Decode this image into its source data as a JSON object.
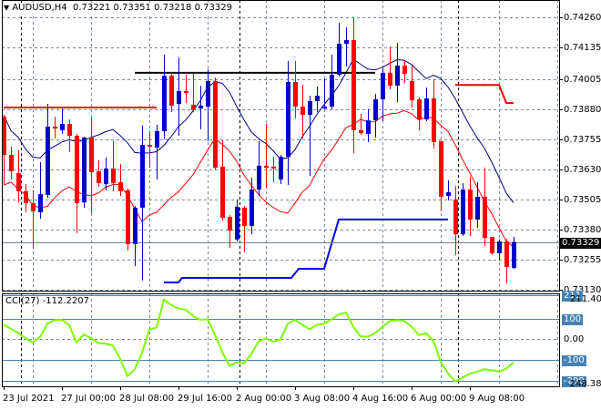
{
  "header": {
    "menu_icon": "triangle-down-icon",
    "symbol": "AUDUSD,H4",
    "ohlc": "0.73221 0.73351 0.73218 0.73329"
  },
  "indicator": {
    "label": "CCI(27) -112.2207"
  },
  "colors": {
    "bull": "#0000c8",
    "bear": "#ff0000",
    "ma_upper": "#000080",
    "ma_lower": "#ff0000",
    "cci": "#7cfc00",
    "level": "#4682b4",
    "grid": "#778899"
  },
  "chart_data": [
    {
      "type": "candlestick",
      "title": "AUDUSD,H4",
      "ylabel": "",
      "ylim": [
        0.7313,
        0.7426
      ],
      "y_ticks": [
        "0.74260",
        "0.74135",
        "0.74005",
        "0.73880",
        "0.73755",
        "0.73630",
        "0.73505",
        "0.73380",
        "0.73255",
        "0.73130"
      ],
      "current_price": "0.73329",
      "x_tick_labels": [
        {
          "bar": 0,
          "label": "23 Jul 2021"
        },
        {
          "bar": 8,
          "label": "27 Jul 00:00"
        },
        {
          "bar": 16,
          "label": "28 Jul 08:00"
        },
        {
          "bar": 24,
          "label": "29 Jul 16:00"
        },
        {
          "bar": 32,
          "label": "2 Aug 00:00"
        },
        {
          "bar": 40,
          "label": "3 Aug 08:00"
        },
        {
          "bar": 48,
          "label": "4 Aug 16:00"
        },
        {
          "bar": 56,
          "label": "6 Aug 00:00"
        },
        {
          "bar": 64,
          "label": "9 Aug 08:00"
        }
      ],
      "period_separators": [
        2,
        32,
        62
      ],
      "ohlc": [
        [
          0.73848,
          0.73856,
          0.73565,
          0.7369
        ],
        [
          0.7369,
          0.73724,
          0.73588,
          0.73622
        ],
        [
          0.73614,
          0.73709,
          0.73493,
          0.73539
        ],
        [
          0.73539,
          0.73569,
          0.73452,
          0.7349
        ],
        [
          0.7349,
          0.73543,
          0.73301,
          0.73456
        ],
        [
          0.73452,
          0.7366,
          0.73425,
          0.73527
        ],
        [
          0.73524,
          0.73901,
          0.73512,
          0.73807
        ],
        [
          0.73807,
          0.73848,
          0.73758,
          0.73799
        ],
        [
          0.73792,
          0.73882,
          0.73777,
          0.73818
        ],
        [
          0.73818,
          0.73837,
          0.73701,
          0.73769
        ],
        [
          0.73769,
          0.73777,
          0.73365,
          0.7349
        ],
        [
          0.73493,
          0.73765,
          0.73471,
          0.73762
        ],
        [
          0.73762,
          0.73845,
          0.73448,
          0.73618
        ],
        [
          0.73622,
          0.73667,
          0.73558,
          0.73573
        ],
        [
          0.73569,
          0.73679,
          0.73543,
          0.73633
        ],
        [
          0.73633,
          0.73747,
          0.73539,
          0.73573
        ],
        [
          0.73577,
          0.73652,
          0.7352,
          0.73539
        ],
        [
          0.73543,
          0.7355,
          0.73293,
          0.7332
        ],
        [
          0.7332,
          0.73478,
          0.73229,
          0.73471
        ],
        [
          0.73471,
          0.73811,
          0.73169,
          0.73731
        ],
        [
          0.73731,
          0.73788,
          0.73637,
          0.73724
        ],
        [
          0.7372,
          0.73814,
          0.73588,
          0.73788
        ],
        [
          0.73788,
          0.74105,
          0.73754,
          0.74018
        ],
        [
          0.74018,
          0.7403,
          0.73867,
          0.73894
        ],
        [
          0.73901,
          0.74094,
          0.73769,
          0.73954
        ],
        [
          0.73954,
          0.74022,
          0.73905,
          0.73947
        ],
        [
          0.73898,
          0.74026,
          0.73867,
          0.73875
        ],
        [
          0.73882,
          0.73977,
          0.73796,
          0.73894
        ],
        [
          0.7389,
          0.74045,
          0.73747,
          0.73996
        ],
        [
          0.73996,
          0.74011,
          0.73629,
          0.73637
        ],
        [
          0.73641,
          0.7375,
          0.73418,
          0.73429
        ],
        [
          0.73433,
          0.73441,
          0.73305,
          0.73376
        ],
        [
          0.73339,
          0.73505,
          0.73331,
          0.73475
        ],
        [
          0.73471,
          0.73478,
          0.73286,
          0.73395
        ],
        [
          0.73395,
          0.73595,
          0.73361,
          0.73546
        ],
        [
          0.73546,
          0.73747,
          0.7352,
          0.73645
        ],
        [
          0.73645,
          0.73818,
          0.7355,
          0.73637
        ],
        [
          0.73641,
          0.73682,
          0.73577,
          0.73633
        ],
        [
          0.73588,
          0.7369,
          0.73569,
          0.73682
        ],
        [
          0.73682,
          0.74079,
          0.73565,
          0.73992
        ],
        [
          0.73992,
          0.74079,
          0.73841,
          0.7389
        ],
        [
          0.7389,
          0.73981,
          0.73758,
          0.73856
        ],
        [
          0.73856,
          0.73935,
          0.73603,
          0.73913
        ],
        [
          0.73913,
          0.73973,
          0.73867,
          0.73935
        ],
        [
          0.73882,
          0.74007,
          0.73879,
          0.7389
        ],
        [
          0.7389,
          0.74105,
          0.73879,
          0.74022
        ],
        [
          0.74022,
          0.74237,
          0.74015,
          0.7415
        ],
        [
          0.7415,
          0.74218,
          0.74056,
          0.74166
        ],
        [
          0.74166,
          0.7426,
          0.73697,
          0.73792
        ],
        [
          0.73792,
          0.7386,
          0.73773,
          0.7378
        ],
        [
          0.73777,
          0.73879,
          0.73743,
          0.73833
        ],
        [
          0.73833,
          0.73943,
          0.73762,
          0.7392
        ],
        [
          0.7392,
          0.74049,
          0.7383,
          0.7403
        ],
        [
          0.7403,
          0.74139,
          0.73962,
          0.73977
        ],
        [
          0.73977,
          0.74154,
          0.73909,
          0.7406
        ],
        [
          0.7406,
          0.74079,
          0.73988,
          0.74026
        ],
        [
          0.73996,
          0.7406,
          0.73886,
          0.73916
        ],
        [
          0.7392,
          0.73928,
          0.73792,
          0.73837
        ],
        [
          0.73837,
          0.73969,
          0.7383,
          0.73924
        ],
        [
          0.73924,
          0.74003,
          0.73716,
          0.73743
        ],
        [
          0.73747,
          0.73747,
          0.73456,
          0.73516
        ],
        [
          0.7352,
          0.73584,
          0.73501,
          0.73535
        ],
        [
          0.73505,
          0.73561,
          0.73275,
          0.73361
        ],
        [
          0.73361,
          0.73573,
          0.73354,
          0.73546
        ],
        [
          0.73546,
          0.73599,
          0.73354,
          0.73422
        ],
        [
          0.73422,
          0.73577,
          0.73388,
          0.73516
        ],
        [
          0.73516,
          0.73637,
          0.73312,
          0.73346
        ],
        [
          0.7335,
          0.7335,
          0.73275,
          0.73282
        ],
        [
          0.73282,
          0.73339,
          0.73252,
          0.73331
        ],
        [
          0.73331,
          0.73342,
          0.73157,
          0.73225
        ],
        [
          0.73221,
          0.73351,
          0.73218,
          0.73329
        ]
      ],
      "moving_averages": [
        {
          "name": "upper",
          "source": "high",
          "period": 10
        },
        {
          "name": "lower",
          "source": "low",
          "period": 10
        }
      ],
      "levels": [
        {
          "color": "red",
          "points": [
            [
              0,
              0.73886
            ],
            [
              21,
              0.73886
            ]
          ]
        },
        {
          "color": "black",
          "points": [
            [
              18,
              0.7403
            ],
            [
              51,
              0.7403
            ]
          ]
        },
        {
          "color": "red",
          "points": [
            [
              62,
              0.7398
            ],
            [
              68,
              0.7398
            ],
            [
              69,
              0.73905
            ],
            [
              70,
              0.73905
            ]
          ]
        },
        {
          "color": "blue",
          "points": [
            [
              22,
              0.73161
            ],
            [
              24,
              0.73161
            ],
            [
              24.5,
              0.7318
            ],
            [
              39.5,
              0.7318
            ],
            [
              40.5,
              0.73218
            ],
            [
              44,
              0.73218
            ],
            [
              46,
              0.73422
            ],
            [
              61,
              0.73422
            ]
          ]
        }
      ]
    },
    {
      "type": "line",
      "title": "CCI(27) -112.2207",
      "ylim": [
        -248.381,
        211.4057
      ],
      "y_ticks": [
        "211.4057",
        "0.00",
        "-248.381"
      ],
      "levels": [
        {
          "value": 211,
          "label": "211"
        },
        {
          "value": 100,
          "label": "100"
        },
        {
          "value": -100,
          "label": "-100"
        },
        {
          "value": -200,
          "label": "-200"
        }
      ],
      "zero_label": "0.00",
      "values": [
        70,
        50,
        30,
        5,
        -16,
        10,
        75,
        93,
        94,
        68,
        -16,
        24,
        4,
        -19,
        -22,
        -31,
        -95,
        -178,
        -145,
        -65,
        46,
        57,
        191,
        165,
        148,
        143,
        112,
        94,
        97,
        22,
        -62,
        -128,
        -112,
        -116,
        -72,
        -10,
        3,
        -12,
        -2,
        75,
        94,
        70,
        48,
        70,
        75,
        95,
        120,
        129,
        60,
        14,
        12,
        30,
        60,
        88,
        93,
        88,
        61,
        20,
        28,
        -8,
        -110,
        -165,
        -205,
        -185,
        -167,
        -157,
        -145,
        -150,
        -157,
        -142,
        -112.22
      ]
    }
  ]
}
